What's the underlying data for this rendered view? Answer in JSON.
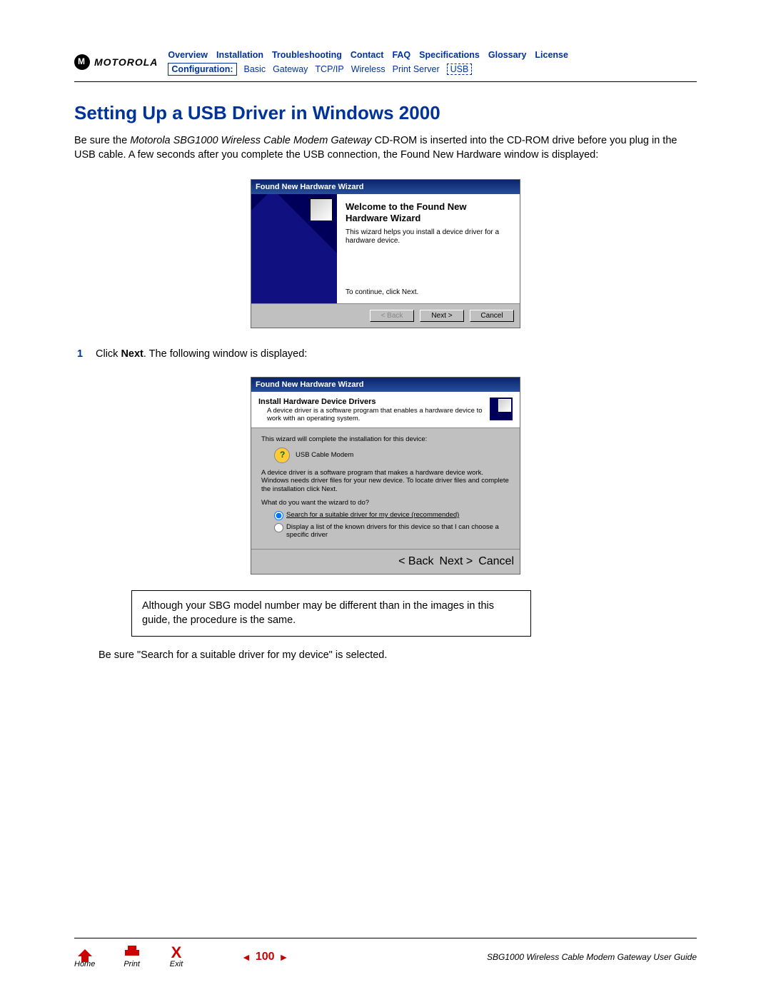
{
  "header": {
    "brand": "MOTOROLA",
    "nav_top": [
      "Overview",
      "Installation",
      "Troubleshooting",
      "Contact",
      "FAQ",
      "Specifications",
      "Glossary",
      "License"
    ],
    "nav_sub_label": "Configuration:",
    "nav_sub_items": [
      "Basic",
      "Gateway",
      "TCP/IP",
      "Wireless",
      "Print Server"
    ],
    "nav_sub_active": "USB"
  },
  "title": "Setting Up a USB Driver in Windows 2000",
  "intro": {
    "pre": "Be sure the ",
    "ital": "Motorola SBG1000 Wireless Cable Modem Gateway",
    "post": " CD-ROM is inserted into the CD-ROM drive before you plug in the USB cable. A few seconds after you complete the USB connection, the Found New Hardware window is displayed:"
  },
  "dlg1": {
    "titlebar": "Found New Hardware Wizard",
    "h1": "Welcome to the Found New",
    "h2": "Hardware Wizard",
    "desc": "This wizard helps you install a device driver for a hardware device.",
    "cont": "To continue, click Next.",
    "back": "< Back",
    "next": "Next >",
    "cancel": "Cancel"
  },
  "step1": {
    "num": "1",
    "pre": "Click ",
    "bold": "Next",
    "post": ". The following window is displayed:"
  },
  "dlg2": {
    "titlebar": "Found New Hardware Wizard",
    "head_title": "Install Hardware Device Drivers",
    "head_desc": "A device driver is a software program that enables a hardware device to work with an operating system.",
    "row1": "This wizard will complete the installation for this device:",
    "device": "USB Cable Modem",
    "para2": "A device driver is a software program that makes a hardware device work. Windows needs driver files for your new device. To locate driver files and complete the installation click Next.",
    "question": "What do you want the wizard to do?",
    "opt1": "Search for a suitable driver for my device (recommended)",
    "opt2": "Display a list of the known drivers for this device so that I can choose a specific driver",
    "back": "< Back",
    "next": "Next >",
    "cancel": "Cancel"
  },
  "notebox": "Although your SBG model number may be different than in the images in this guide, the procedure is the same.",
  "post_note": "Be sure \"Search for a suitable driver for my device\" is selected.",
  "footer": {
    "home": "Home",
    "print": "Print",
    "exit": "Exit",
    "prev": "◄",
    "page": "100",
    "nextarr": "►",
    "guide": "SBG1000 Wireless Cable Modem Gateway User Guide"
  }
}
